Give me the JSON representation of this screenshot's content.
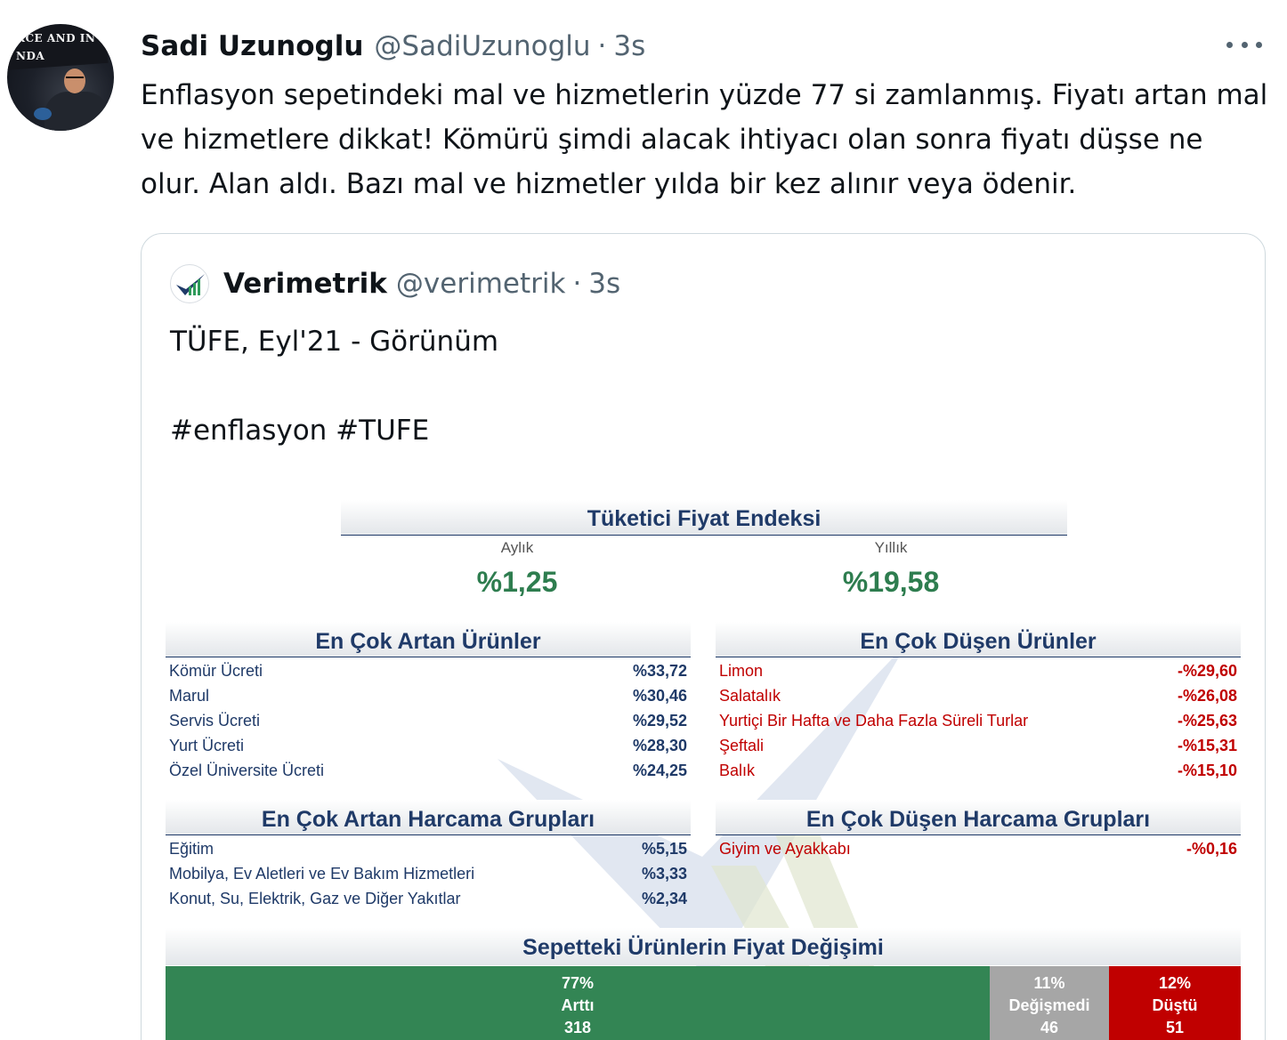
{
  "author": {
    "name": "Sadi Uzunoglu",
    "handle": "@SadiUzunoglu",
    "time": "3s",
    "avatar_banner_text": "RCE AND IN\nNDA"
  },
  "tweet_text": "Enflasyon sepetindeki mal ve hizmetlerin yüzde 77 si zamlanmış. Fiyatı artan mal ve hizmetlere dikkat! Kömürü şimdi alacak ihtiyacı olan sonra fiyatı düşse ne olur. Alan aldı. Bazı mal ve hizmetler yılda bir kez alınır veya ödenir.",
  "more_icon": "more-horizontal-icon",
  "quote": {
    "name": "Verimetrik",
    "handle": "@verimetrik",
    "time": "3s",
    "text": "TÜFE, Eyl'21 - Görünüm\n\n#enflasyon #TUFE",
    "avatar_icon": "verimetrik-logo-icon"
  },
  "infographic": {
    "title": "Tüketici Fiyat Endeksi",
    "monthly_label": "Aylık",
    "monthly_value": "%1,25",
    "yearly_label": "Yıllık",
    "yearly_value": "%19,58",
    "top_rising_title": "En Çok Artan Ürünler",
    "top_rising": [
      {
        "label": "Kömür Ücreti",
        "value": "%33,72"
      },
      {
        "label": "Marul",
        "value": "%30,46"
      },
      {
        "label": "Servis Ücreti",
        "value": "%29,52"
      },
      {
        "label": "Yurt Ücreti",
        "value": "%28,30"
      },
      {
        "label": "Özel Üniversite Ücreti",
        "value": "%24,25"
      }
    ],
    "top_falling_title": "En Çok Düşen Ürünler",
    "top_falling": [
      {
        "label": "Limon",
        "value": "-%29,60"
      },
      {
        "label": "Salatalık",
        "value": "-%26,08"
      },
      {
        "label": "Yurtiçi Bir Hafta ve Daha Fazla Süreli Turlar",
        "value": "-%25,63"
      },
      {
        "label": "Şeftali",
        "value": "-%15,31"
      },
      {
        "label": "Balık",
        "value": "-%15,10"
      }
    ],
    "rising_groups_title": "En Çok Artan Harcama Grupları",
    "rising_groups": [
      {
        "label": "Eğitim",
        "value": "%5,15"
      },
      {
        "label": "Mobilya, Ev Aletleri ve Ev Bakım Hizmetleri",
        "value": "%3,33"
      },
      {
        "label": "Konut, Su, Elektrik, Gaz ve Diğer Yakıtlar",
        "value": "%2,34"
      }
    ],
    "falling_groups_title": "En Çok Düşen Harcama Grupları",
    "falling_groups": [
      {
        "label": "Giyim ve Ayakkabı",
        "value": "-%0,16"
      }
    ],
    "basket_title": "Sepetteki Ürünlerin Fiyat Değişimi",
    "colors": {
      "navy": "#1f3a68",
      "green": "#2e7d4f",
      "red": "#c00000",
      "gray": "#a6a6a6"
    }
  },
  "chart_data": {
    "type": "bar",
    "title": "Sepetteki Ürünlerin Fiyat Değişimi",
    "categories": [
      "Arttı",
      "Değişmedi",
      "Düştü"
    ],
    "percent_labels": [
      "77%",
      "11%",
      "12%"
    ],
    "values": [
      318,
      46,
      51
    ],
    "colors": [
      "#338554",
      "#a6a6a6",
      "#c00000"
    ]
  }
}
